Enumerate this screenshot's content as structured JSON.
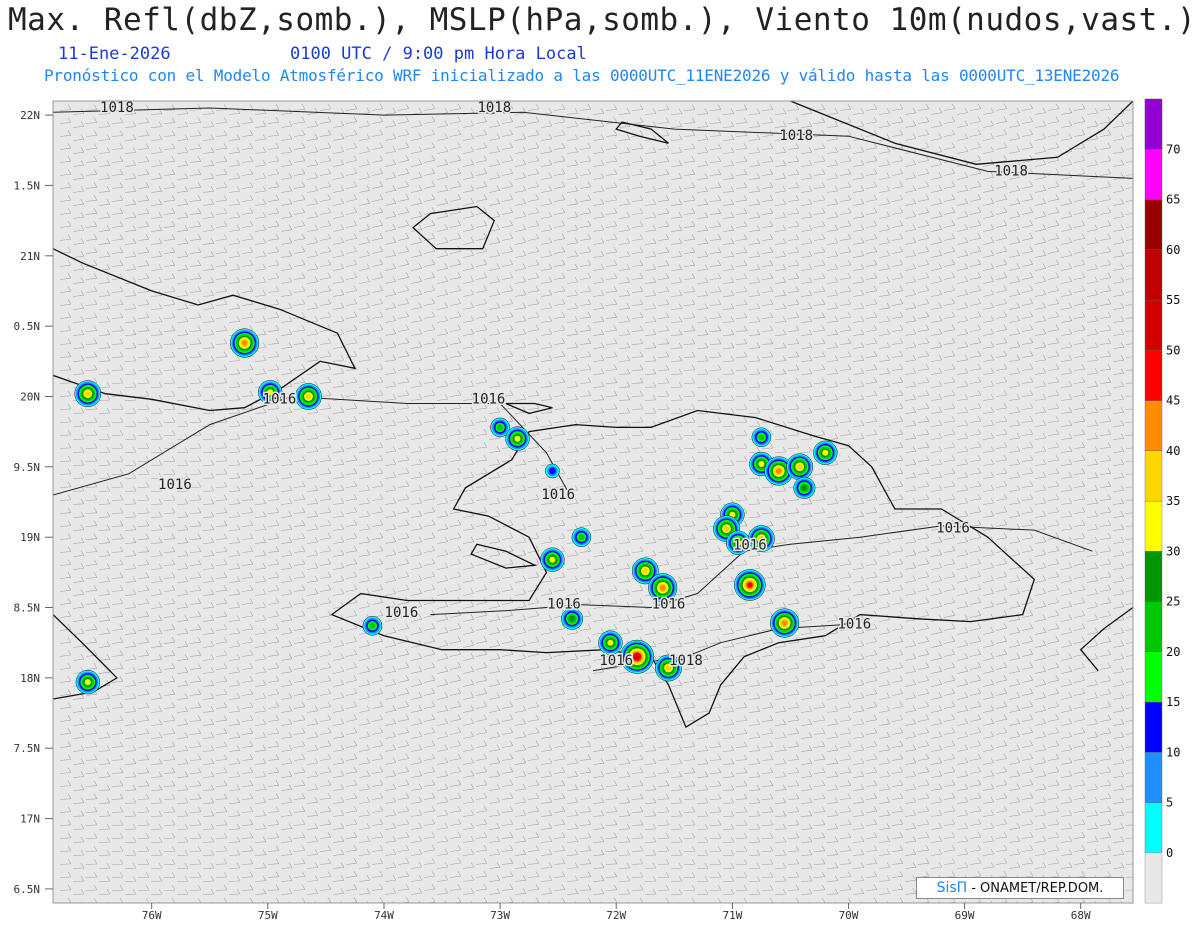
{
  "header": {
    "title": "Max. Refl(dbZ,somb.), MSLP(hPa,somb.), Viento 10m(nudos,vast.)",
    "date": "11-Ene-2026",
    "time": "0100 UTC / 9:00 pm Hora Local",
    "description": "Pronóstico con el Modelo Atmosférico WRF inicializado a las 0000UTC_11ENE2026 y válido hasta las  0000UTC_13ENE2026"
  },
  "credit": {
    "brand": "SisΠ",
    "text": "- ONAMET/REP.DOM."
  },
  "chart_data": {
    "type": "map",
    "projection": "lat-lon",
    "lon_range": [
      -76.85,
      -67.55
    ],
    "lat_range": [
      16.4,
      22.1
    ],
    "lon_ticks": [
      {
        "lon": -76,
        "label": "76W"
      },
      {
        "lon": -75,
        "label": "75W"
      },
      {
        "lon": -74,
        "label": "74W"
      },
      {
        "lon": -73,
        "label": "73W"
      },
      {
        "lon": -72,
        "label": "72W"
      },
      {
        "lon": -71,
        "label": "71W"
      },
      {
        "lon": -70,
        "label": "70W"
      },
      {
        "lon": -69,
        "label": "69W"
      },
      {
        "lon": -68,
        "label": "68W"
      }
    ],
    "lat_ticks": [
      {
        "lat": 22,
        "label": "22N"
      },
      {
        "lat": 21.5,
        "label": "1.5N"
      },
      {
        "lat": 21,
        "label": "21N"
      },
      {
        "lat": 20.5,
        "label": "0.5N"
      },
      {
        "lat": 20,
        "label": "20N"
      },
      {
        "lat": 19.5,
        "label": "9.5N"
      },
      {
        "lat": 19,
        "label": "19N"
      },
      {
        "lat": 18.5,
        "label": "8.5N"
      },
      {
        "lat": 18,
        "label": "18N"
      },
      {
        "lat": 17.5,
        "label": "7.5N"
      },
      {
        "lat": 17,
        "label": "17N"
      },
      {
        "lat": 16.5,
        "label": "6.5N"
      }
    ],
    "colorbar": {
      "unit": "dBZ",
      "levels": [
        "0",
        "5",
        "10",
        "15",
        "20",
        "25",
        "30",
        "35",
        "40",
        "45",
        "50",
        "55",
        "60",
        "65",
        "70"
      ],
      "colors": [
        "#00ffff",
        "#1e90ff",
        "#0000ff",
        "#00ff00",
        "#00c800",
        "#009600",
        "#ffff00",
        "#ffd700",
        "#ff8c00",
        "#ff0000",
        "#d40000",
        "#c00000",
        "#9b0000",
        "#ff00ff",
        "#9400d3"
      ],
      "background": "#e8e8e8"
    },
    "isobar_labels": [
      {
        "lon": -76.3,
        "lat": 22.05,
        "text": "1018"
      },
      {
        "lon": -73.05,
        "lat": 22.05,
        "text": "1018"
      },
      {
        "lon": -70.45,
        "lat": 21.85,
        "text": "1018"
      },
      {
        "lon": -68.6,
        "lat": 21.6,
        "text": "1018"
      },
      {
        "lon": -74.9,
        "lat": 19.98,
        "text": "1016"
      },
      {
        "lon": -73.1,
        "lat": 19.98,
        "text": "1016"
      },
      {
        "lon": -75.8,
        "lat": 19.37,
        "text": "1016"
      },
      {
        "lon": -72.5,
        "lat": 19.3,
        "text": "1016"
      },
      {
        "lon": -69.1,
        "lat": 19.06,
        "text": "1016"
      },
      {
        "lon": -70.85,
        "lat": 18.94,
        "text": "1016"
      },
      {
        "lon": -73.85,
        "lat": 18.46,
        "text": "1016"
      },
      {
        "lon": -72.45,
        "lat": 18.52,
        "text": "1016"
      },
      {
        "lon": -71.55,
        "lat": 18.52,
        "text": "1016"
      },
      {
        "lon": -69.95,
        "lat": 18.38,
        "text": "1016"
      },
      {
        "lon": -72.0,
        "lat": 18.12,
        "text": "1016"
      },
      {
        "lon": -71.4,
        "lat": 18.12,
        "text": "1018"
      }
    ],
    "reflectivity_cells": [
      {
        "lon": -75.2,
        "lat": 20.38,
        "dbz": 40
      },
      {
        "lon": -76.55,
        "lat": 20.02,
        "dbz": 35
      },
      {
        "lon": -74.98,
        "lat": 20.03,
        "dbz": 30
      },
      {
        "lon": -74.65,
        "lat": 20.0,
        "dbz": 35
      },
      {
        "lon": -73.0,
        "lat": 19.78,
        "dbz": 20
      },
      {
        "lon": -72.85,
        "lat": 19.7,
        "dbz": 30
      },
      {
        "lon": -72.55,
        "lat": 19.47,
        "dbz": 10
      },
      {
        "lon": -70.75,
        "lat": 19.71,
        "dbz": 20
      },
      {
        "lon": -70.2,
        "lat": 19.6,
        "dbz": 30
      },
      {
        "lon": -70.75,
        "lat": 19.52,
        "dbz": 30
      },
      {
        "lon": -70.6,
        "lat": 19.47,
        "dbz": 40
      },
      {
        "lon": -70.42,
        "lat": 19.5,
        "dbz": 35
      },
      {
        "lon": -70.38,
        "lat": 19.35,
        "dbz": 25
      },
      {
        "lon": -71.0,
        "lat": 19.16,
        "dbz": 30
      },
      {
        "lon": -71.05,
        "lat": 19.06,
        "dbz": 35
      },
      {
        "lon": -70.95,
        "lat": 18.96,
        "dbz": 30
      },
      {
        "lon": -70.75,
        "lat": 18.99,
        "dbz": 35
      },
      {
        "lon": -72.55,
        "lat": 18.84,
        "dbz": 30
      },
      {
        "lon": -72.3,
        "lat": 19.0,
        "dbz": 20
      },
      {
        "lon": -71.75,
        "lat": 18.76,
        "dbz": 35
      },
      {
        "lon": -71.6,
        "lat": 18.64,
        "dbz": 40
      },
      {
        "lon": -70.85,
        "lat": 18.66,
        "dbz": 45
      },
      {
        "lon": -70.55,
        "lat": 18.39,
        "dbz": 40
      },
      {
        "lon": -72.38,
        "lat": 18.42,
        "dbz": 25
      },
      {
        "lon": -74.1,
        "lat": 18.37,
        "dbz": 20
      },
      {
        "lon": -72.05,
        "lat": 18.25,
        "dbz": 30
      },
      {
        "lon": -71.82,
        "lat": 18.15,
        "dbz": 50
      },
      {
        "lon": -71.55,
        "lat": 18.07,
        "dbz": 35
      },
      {
        "lon": -76.55,
        "lat": 17.97,
        "dbz": 30
      }
    ]
  }
}
